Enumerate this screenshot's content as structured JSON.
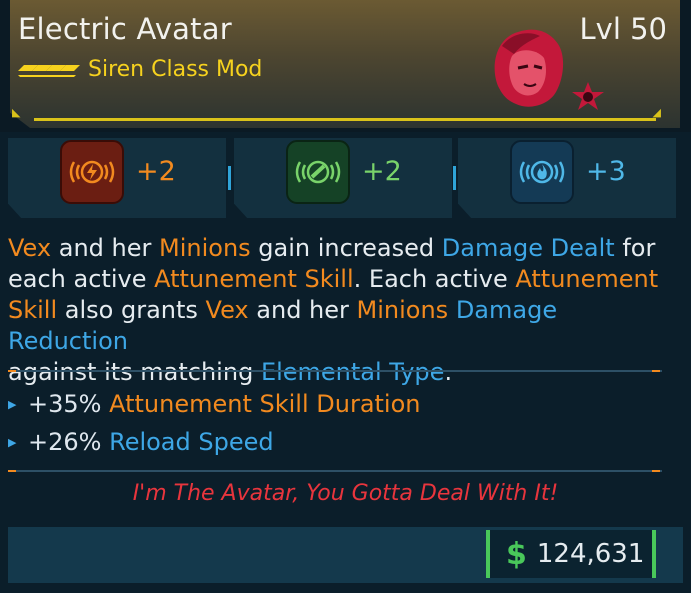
{
  "item": {
    "name": "Electric Avatar",
    "level": "Lvl 50",
    "subtitle": "Siren Class Mod",
    "rarity_icon": "legendary-chevrons-icon",
    "portrait_icon": "vex-portrait-icon"
  },
  "slots": [
    {
      "icon": "lightning-attunement-icon",
      "value": "+2",
      "color": "#f28a1f"
    },
    {
      "icon": "corrosive-attunement-icon",
      "value": "+2",
      "color": "#79d36a"
    },
    {
      "icon": "fire-attunement-icon",
      "value": "+3",
      "color": "#4fb8e8"
    }
  ],
  "description": {
    "line1": [
      "Vex",
      " and her ",
      "Minions",
      " gain increased ",
      "Damage Dealt",
      " for"
    ],
    "line2": [
      "each active ",
      "Attunement Skill",
      ". Each active ",
      "Attunement"
    ],
    "line3": [
      "Skill",
      " also grants ",
      "Vex",
      " and her ",
      "Minions",
      " ",
      "Damage Reduction"
    ],
    "line4": [
      "against its matching ",
      "Elemental Type",
      "."
    ]
  },
  "stats": [
    {
      "value": "+35%",
      "label": "Attunement Skill Duration"
    },
    {
      "value": "+26%",
      "label": "Reload Speed"
    }
  ],
  "flavor_text": "I'm The Avatar, You Gotta Deal With It!",
  "price": {
    "currency_icon": "dollar-icon",
    "currency_symbol": "$",
    "amount": "124,631"
  },
  "colors": {
    "accent_orange": "#f28a1f",
    "accent_blue": "#3ea7e6",
    "legendary_yellow": "#f6d21e",
    "flavor_red": "#e8353d",
    "money_green": "#49c85a"
  }
}
